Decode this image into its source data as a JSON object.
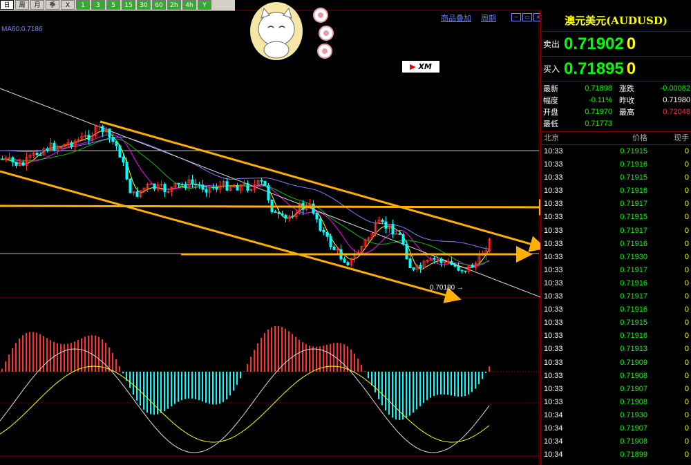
{
  "toolbar": {
    "buttons": [
      "日",
      "周",
      "月",
      "季",
      "X",
      "1",
      "3",
      "5",
      "15",
      "30",
      "60",
      "2h",
      "4h",
      "Y"
    ]
  },
  "chart": {
    "ma_label": "MA60:0.7186",
    "links": [
      "商品叠加",
      "周期"
    ],
    "low_marker": "0.70180",
    "xm_logo": "XM"
  },
  "panel": {
    "title": "澳元美元(AUDUSD)",
    "sell_label": "卖出",
    "sell_price": "0.71902",
    "sell_vol": "0",
    "buy_label": "买入",
    "buy_price": "0.71895",
    "buy_vol": "0",
    "stats": [
      {
        "k": "最新",
        "v": "0.71898",
        "k2": "涨跌",
        "v2": "-0.00082",
        "c2": "#00ff00"
      },
      {
        "k": "幅度",
        "v": "-0.11%",
        "k2": "昨收",
        "v2": "0.71980",
        "c2": "#ffffff"
      },
      {
        "k": "开盘",
        "v": "0.71970",
        "k2": "最高",
        "v2": "0.72048",
        "c2": "#ff3030"
      },
      {
        "k": "最低",
        "v": "0.71773",
        "k2": "",
        "v2": "",
        "c2": "#ffffff"
      }
    ],
    "tick_header": {
      "time": "北京",
      "price": "价格",
      "vol": "现手"
    },
    "ticks": [
      {
        "t": "10:33",
        "p": "0.71915",
        "v": "0"
      },
      {
        "t": "10:33",
        "p": "0.71916",
        "v": "0"
      },
      {
        "t": "10:33",
        "p": "0.71915",
        "v": "0"
      },
      {
        "t": "10:33",
        "p": "0.71916",
        "v": "0"
      },
      {
        "t": "10:33",
        "p": "0.71917",
        "v": "0"
      },
      {
        "t": "10:33",
        "p": "0.71915",
        "v": "0"
      },
      {
        "t": "10:33",
        "p": "0.71917",
        "v": "0"
      },
      {
        "t": "10:33",
        "p": "0.71916",
        "v": "0"
      },
      {
        "t": "10:33",
        "p": "0.71930",
        "v": "0"
      },
      {
        "t": "10:33",
        "p": "0.71917",
        "v": "0"
      },
      {
        "t": "10:33",
        "p": "0.71916",
        "v": "0"
      },
      {
        "t": "10:33",
        "p": "0.71917",
        "v": "0"
      },
      {
        "t": "10:33",
        "p": "0.71916",
        "v": "0"
      },
      {
        "t": "10:33",
        "p": "0.71915",
        "v": "0"
      },
      {
        "t": "10:33",
        "p": "0.71916",
        "v": "0"
      },
      {
        "t": "10:33",
        "p": "0.71913",
        "v": "0"
      },
      {
        "t": "10:33",
        "p": "0.71909",
        "v": "0"
      },
      {
        "t": "10:33",
        "p": "0.71908",
        "v": "0"
      },
      {
        "t": "10:33",
        "p": "0.71907",
        "v": "0"
      },
      {
        "t": "10:33",
        "p": "0.71908",
        "v": "0"
      },
      {
        "t": "10:34",
        "p": "0.71930",
        "v": "0"
      },
      {
        "t": "10:34",
        "p": "0.71907",
        "v": "0"
      },
      {
        "t": "10:34",
        "p": "0.71908",
        "v": "0"
      },
      {
        "t": "10:34",
        "p": "0.71899",
        "v": "0"
      }
    ]
  },
  "colors": {
    "up": "#ff3030",
    "down": "#00ffff",
    "trend": "#ffb000",
    "ma_white": "#e0e0e0",
    "ma_yellow": "#ffff00",
    "ma_pink": "#ff00ff",
    "ma_green": "#00c000",
    "ma_blue": "#8080ff"
  }
}
